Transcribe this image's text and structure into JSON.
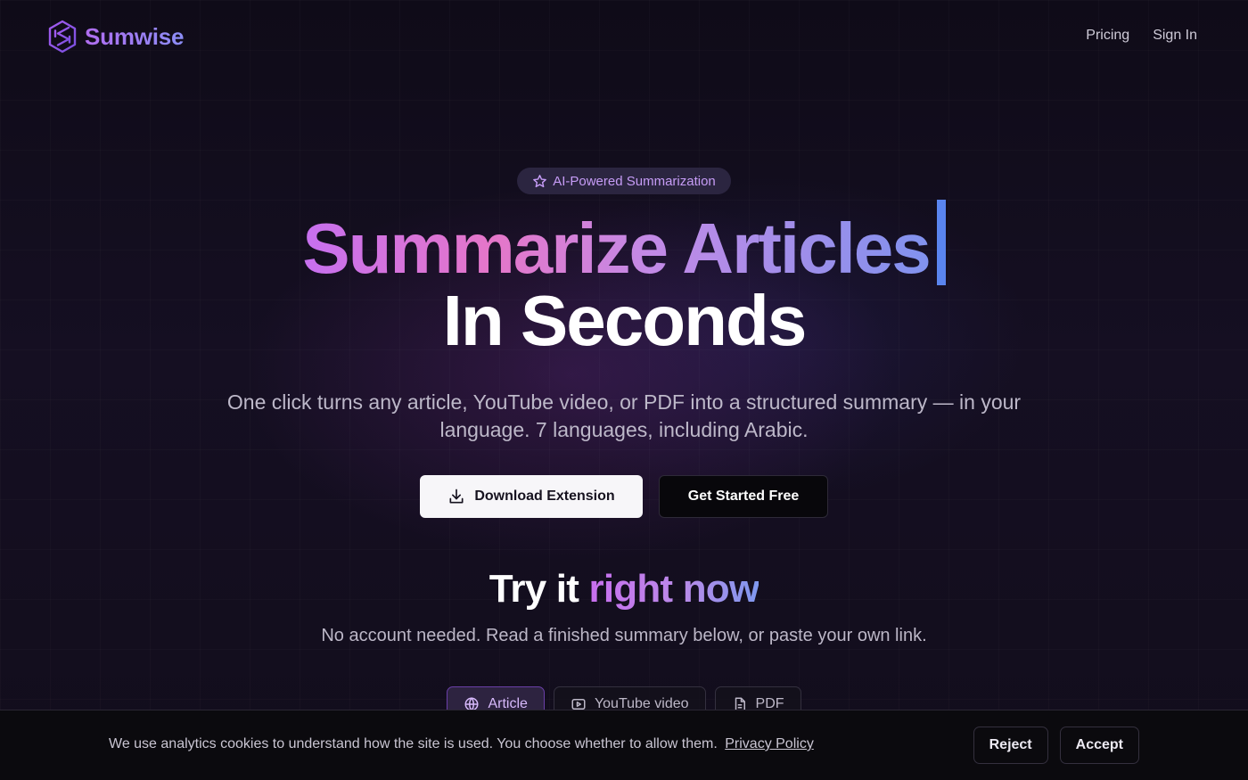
{
  "header": {
    "brand": "Sumwise",
    "nav": [
      {
        "label": "Pricing"
      },
      {
        "label": "Sign In"
      }
    ]
  },
  "hero": {
    "badge": "AI-Powered Summarization",
    "headline_line1": "Summarize Articles",
    "headline_line2": "In Seconds",
    "subtitle": "One click turns any article, YouTube video, or PDF into a structured summary — in your language. 7 languages, including Arabic.",
    "primary_cta": "Download Extension",
    "secondary_cta": "Get Started Free"
  },
  "try_section": {
    "title_plain": "Try it",
    "title_highlight": "right now",
    "subtitle": "No account needed. Read a finished summary below, or paste your own link.",
    "tabs": [
      {
        "label": "Article",
        "icon": "globe-icon",
        "active": true
      },
      {
        "label": "YouTube video",
        "icon": "video-icon",
        "active": false
      },
      {
        "label": "PDF",
        "icon": "file-icon",
        "active": false
      }
    ]
  },
  "cookie": {
    "message": "We use analytics cookies to understand how the site is used. You choose whether to allow them.",
    "policy_link": "Privacy Policy",
    "reject": "Reject",
    "accept": "Accept"
  },
  "colors": {
    "background": "#120d1c",
    "accent_purple": "#c670ef",
    "accent_pink": "#e576c9",
    "accent_blue": "#5a85ef",
    "badge_bg": "#2b2540",
    "badge_text": "#c69cf6"
  }
}
